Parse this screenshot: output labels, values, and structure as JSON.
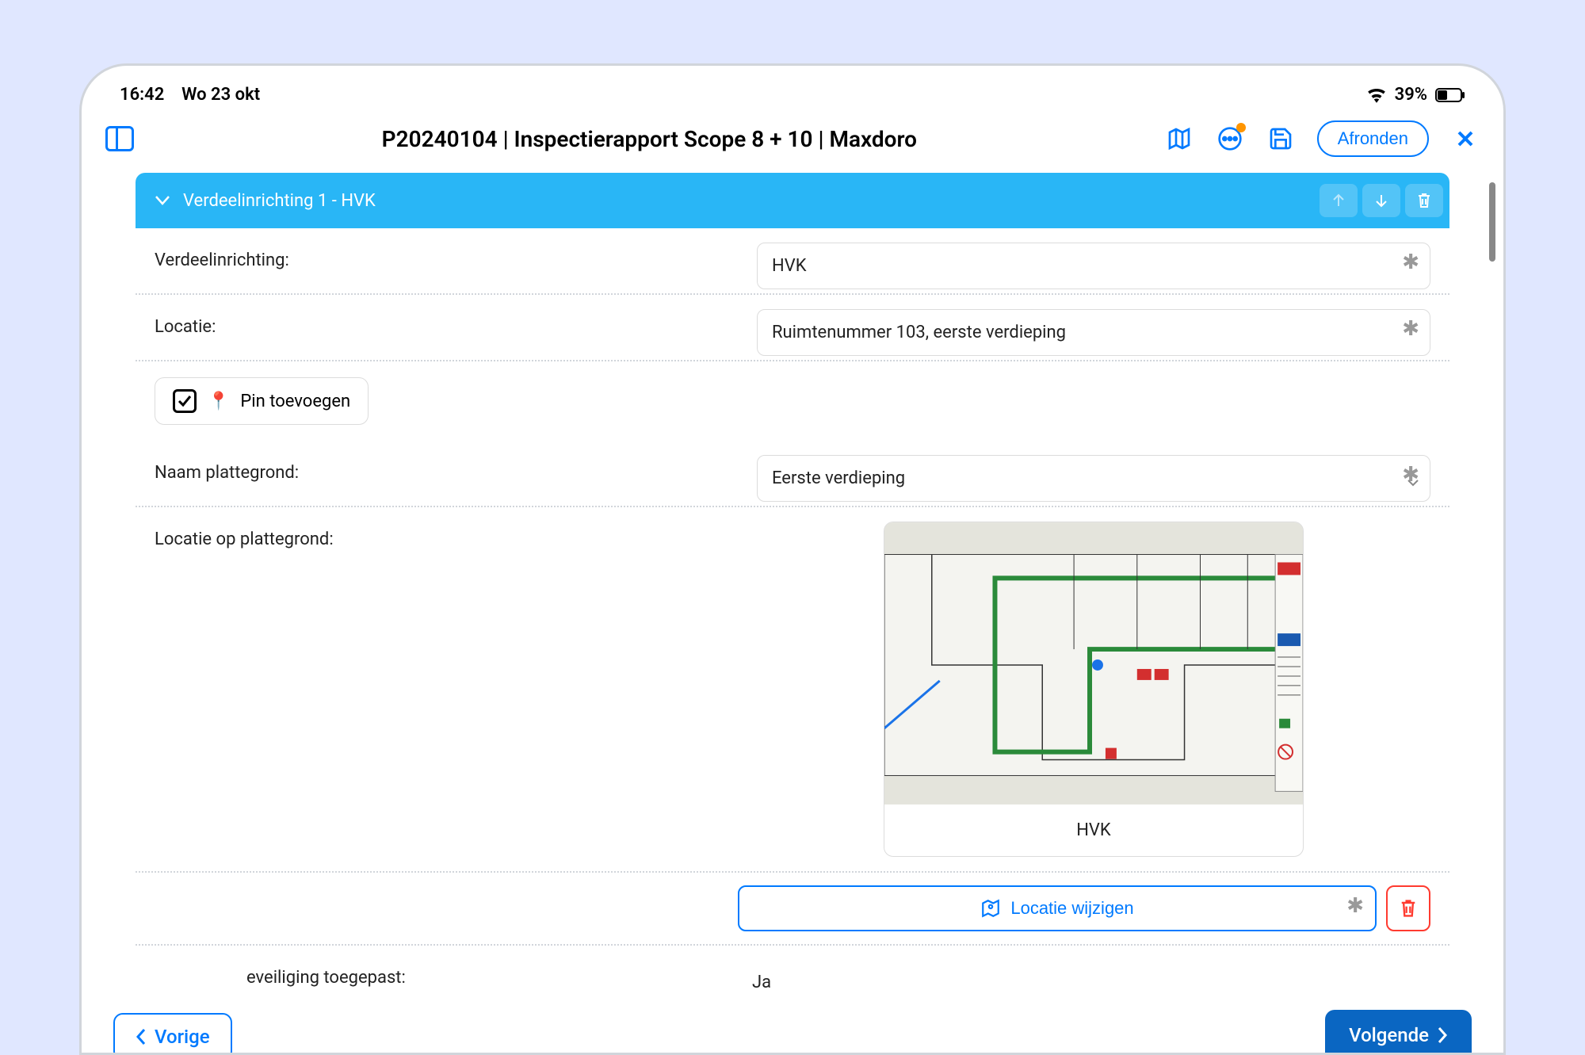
{
  "status": {
    "time": "16:42",
    "date": "Wo 23 okt",
    "battery": "39%"
  },
  "header": {
    "title": "P20240104 | Inspectierapport Scope 8 + 10 | Maxdoro",
    "afronden": "Afronden"
  },
  "panel": {
    "title": "Verdeelinrichting 1 - HVK"
  },
  "form": {
    "verdeelinrichting_label": "Verdeelinrichting:",
    "verdeelinrichting_value": "HVK",
    "locatie_label": "Locatie:",
    "locatie_value": "Ruimtenummer 103, eerste verdieping",
    "pin_label": "Pin toevoegen",
    "naam_plattegrond_label": "Naam plattegrond:",
    "naam_plattegrond_value": "Eerste verdieping",
    "locatie_op_label": "Locatie op plattegrond:",
    "floorplan_caption": "HVK",
    "locatie_wijzigen": "Locatie wijzigen",
    "beveiliging_label": "eveiliging toegepast:",
    "beveiliging_value": "Ja"
  },
  "nav": {
    "prev": "Vorige",
    "next": "Volgende"
  }
}
